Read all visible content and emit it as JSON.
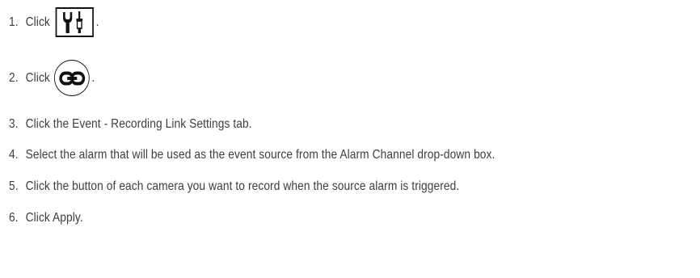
{
  "steps": [
    {
      "number": "1.",
      "text": "Click",
      "icon": "tools-icon",
      "suffix": "."
    },
    {
      "number": "2.",
      "text": "Click",
      "icon": "chain-link-icon",
      "suffix": "."
    },
    {
      "number": "3.",
      "text": "Click the Event - Recording Link Settings tab."
    },
    {
      "number": "4.",
      "text": "Select the alarm that will be used as the event source from the Alarm Channel drop-down box."
    },
    {
      "number": "5.",
      "text": "Click the button of each camera you want to record when the source alarm is triggered."
    },
    {
      "number": "6.",
      "text": "Click Apply."
    }
  ]
}
